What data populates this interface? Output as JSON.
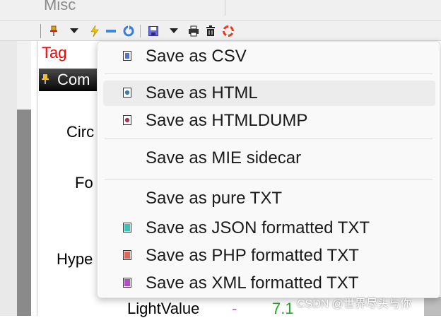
{
  "top_tab": {
    "label": "Misc"
  },
  "property_panel": {
    "tag_label": "Tag",
    "section": "Com",
    "rows": {
      "circ": "Circ",
      "fo": "Fo",
      "hype": "Hype"
    },
    "bottom_row": {
      "name": "LightValue",
      "dash": "-",
      "value": "7.1"
    }
  },
  "toolbar": {
    "icons": [
      "pin-icon",
      "dropdown-arrow-icon",
      "lightning-icon",
      "minus-icon",
      "refresh-icon",
      "save-icon",
      "dropdown-arrow-icon",
      "print-icon",
      "trash-icon",
      "lifebuoy-icon"
    ]
  },
  "menu": {
    "items": [
      {
        "label": "Save as CSV",
        "icon": "csv-file-icon",
        "color": "#5a6fd6"
      },
      {
        "label": "Save as HTML",
        "icon": "html-file-icon",
        "color": "#3a7fa8",
        "highlighted": true
      },
      {
        "label": "Save as HTMLDUMP",
        "icon": "htmldump-file-icon",
        "color": "#9b3a5a"
      },
      {
        "label": "Save as MIE sidecar"
      },
      {
        "label": "Save as pure TXT"
      },
      {
        "label": "Save as JSON formatted TXT",
        "icon": "json-file-icon",
        "color": "#3fc0b8"
      },
      {
        "label": "Save as PHP formatted TXT",
        "icon": "php-file-icon",
        "color": "#e0665a"
      },
      {
        "label": "Save as XML formatted TXT",
        "icon": "xml-file-icon",
        "color": "#b04fc8"
      }
    ]
  },
  "colors": {
    "accent_red": "#ff0000",
    "green_value": "#22aa22",
    "header_black": "#000000"
  },
  "watermark": "CSDN @世界尽头与你"
}
